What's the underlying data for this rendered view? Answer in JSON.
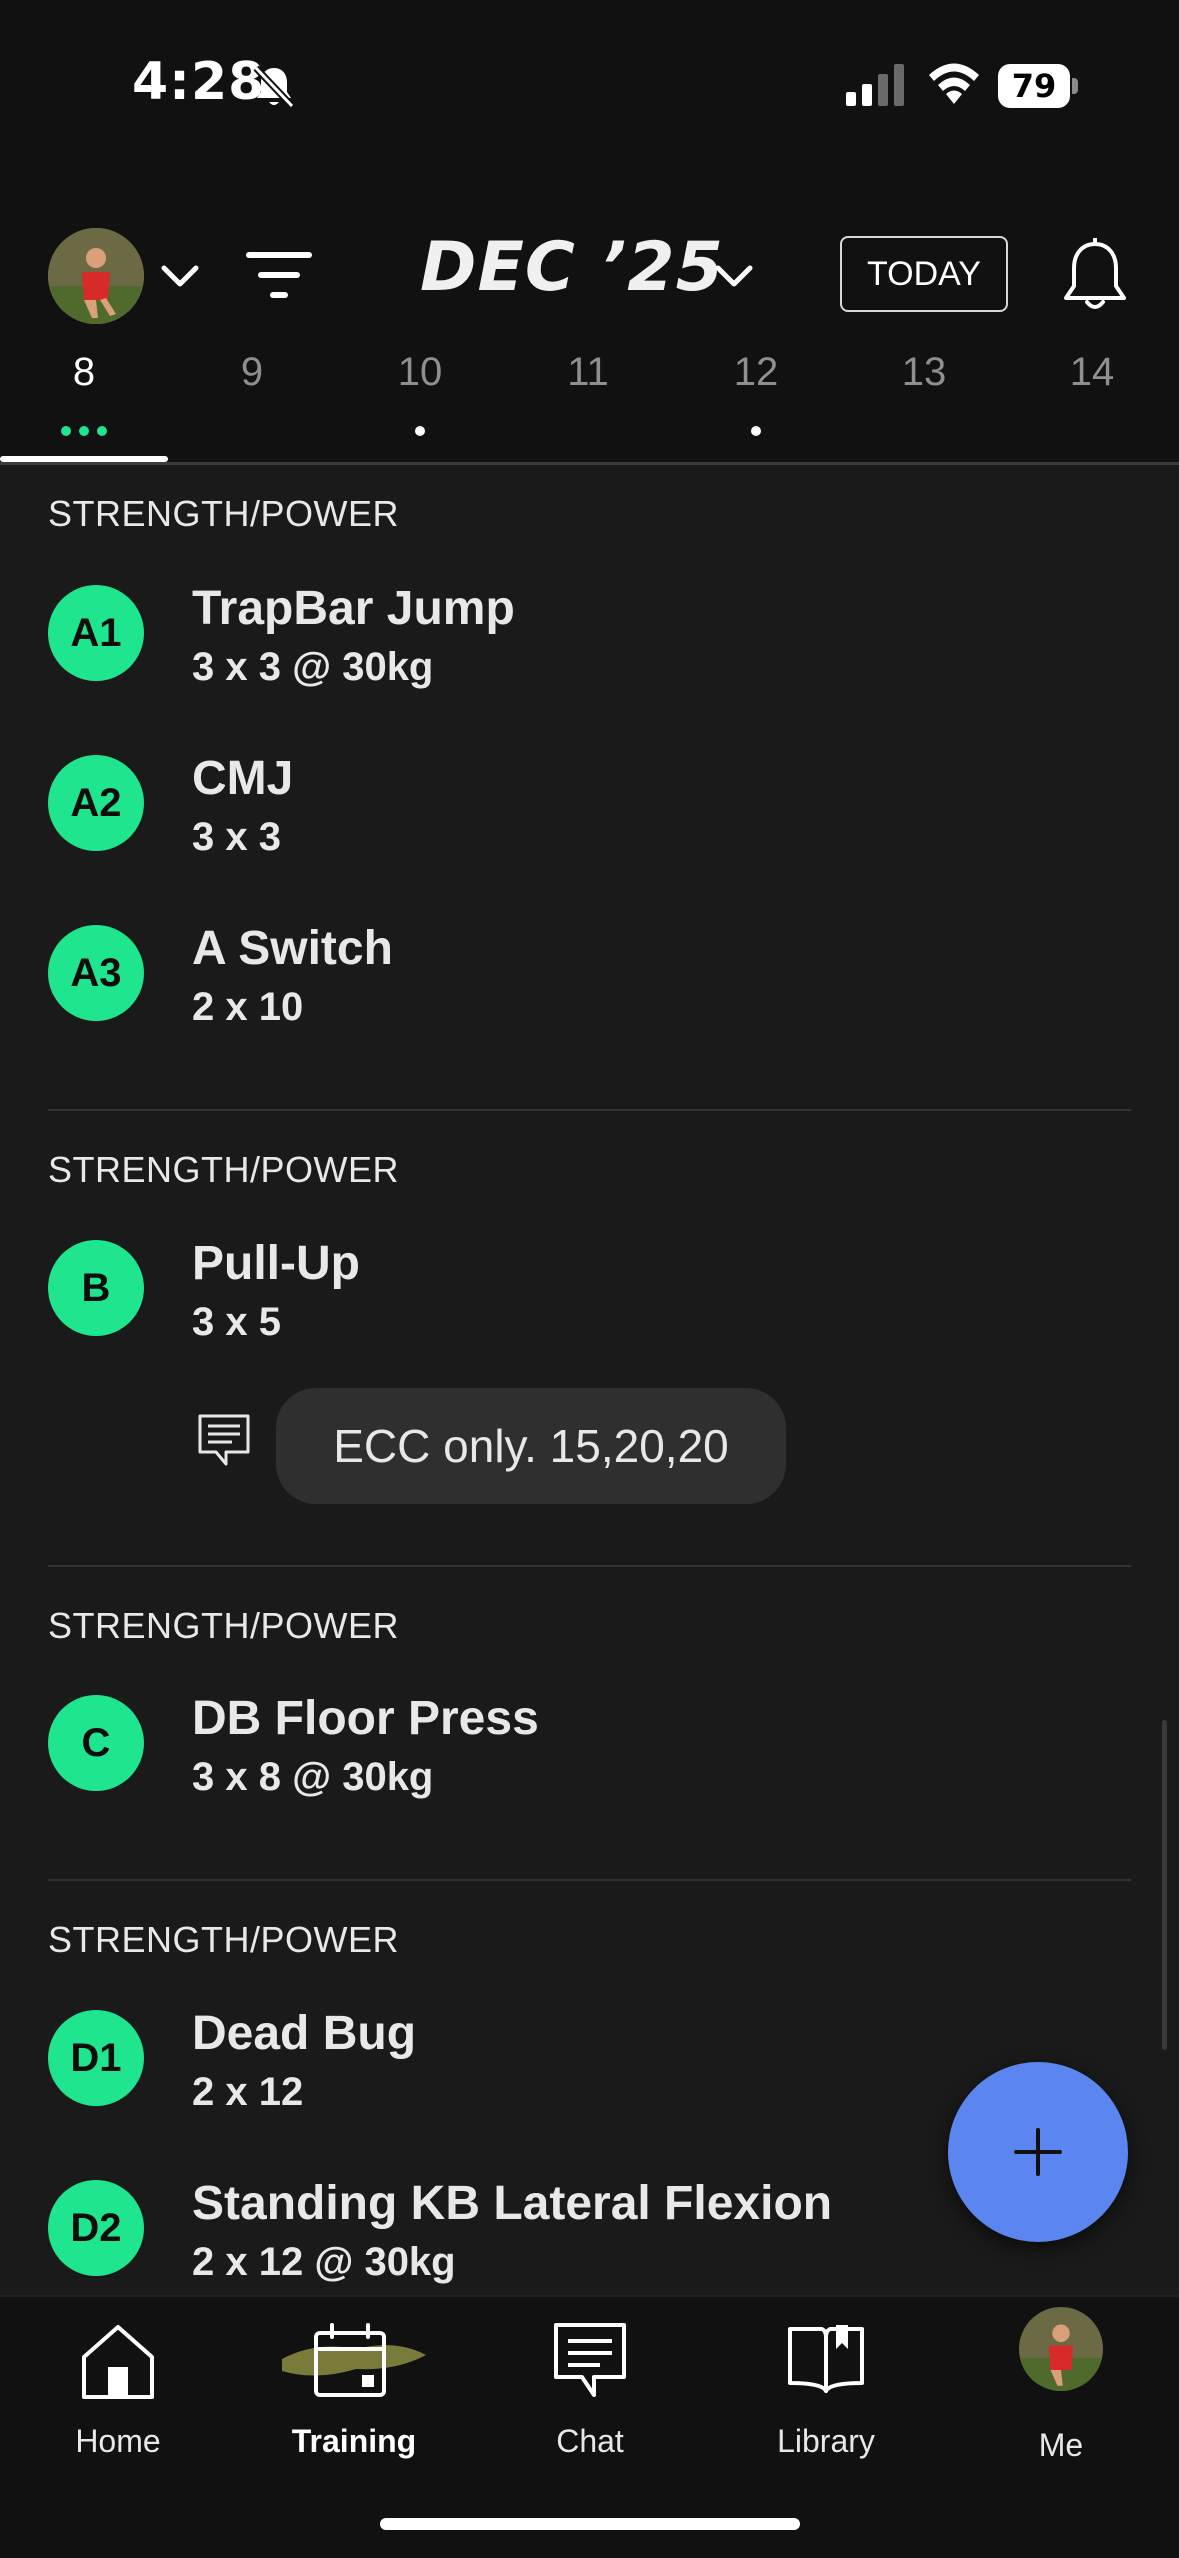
{
  "status_bar": {
    "time": "4:28",
    "battery": "79"
  },
  "header": {
    "month_label": "DEC ’25",
    "today_label": "TODAY"
  },
  "days": [
    {
      "label": "8",
      "selected": true,
      "dots": 3
    },
    {
      "label": "9",
      "selected": false,
      "dots": 0
    },
    {
      "label": "10",
      "selected": false,
      "dots": 1
    },
    {
      "label": "11",
      "selected": false,
      "dots": 0
    },
    {
      "label": "12",
      "selected": false,
      "dots": 1
    },
    {
      "label": "13",
      "selected": false,
      "dots": 0
    },
    {
      "label": "14",
      "selected": false,
      "dots": 0
    }
  ],
  "sections": [
    {
      "title": "STRENGTH/POWER",
      "exercises": [
        {
          "badge": "A1",
          "name": "TrapBar Jump",
          "detail": "3 x 3 @ 30kg"
        },
        {
          "badge": "A2",
          "name": "CMJ",
          "detail": "3 x 3"
        },
        {
          "badge": "A3",
          "name": "A Switch",
          "detail": "2 x 10"
        }
      ]
    },
    {
      "title": "STRENGTH/POWER",
      "exercises": [
        {
          "badge": "B",
          "name": "Pull-Up",
          "detail": "3 x 5",
          "note": "ECC only. 15,20,20"
        }
      ]
    },
    {
      "title": "STRENGTH/POWER",
      "exercises": [
        {
          "badge": "C",
          "name": "DB Floor Press",
          "detail": "3 x 8 @ 30kg"
        }
      ]
    },
    {
      "title": "STRENGTH/POWER",
      "exercises": [
        {
          "badge": "D1",
          "name": "Dead Bug",
          "detail": "2 x 12"
        },
        {
          "badge": "D2",
          "name": "Standing KB Lateral Flexion",
          "detail": "2 x 12 @ 30kg"
        }
      ]
    }
  ],
  "tabs": [
    {
      "label": "Home",
      "icon": "home-icon",
      "active": false
    },
    {
      "label": "Training",
      "icon": "calendar-icon",
      "active": true
    },
    {
      "label": "Chat",
      "icon": "chat-icon",
      "active": false
    },
    {
      "label": "Library",
      "icon": "book-icon",
      "active": false
    },
    {
      "label": "Me",
      "icon": "avatar",
      "active": false
    }
  ],
  "colors": {
    "background": "#1a1a1a",
    "header_background": "#111111",
    "badge": "#1fe58e",
    "fab": "#5b86f0",
    "dot": "#1fe58e"
  }
}
